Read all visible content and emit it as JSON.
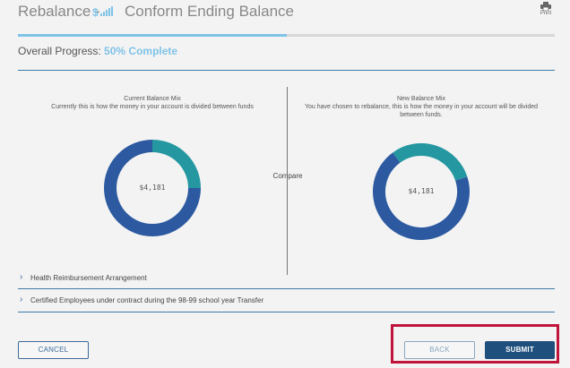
{
  "header": {
    "title": "Rebalance -",
    "subtitle": "Conform Ending Balance",
    "print_label": "Print"
  },
  "progress": {
    "label": "Overall Progress:",
    "percent_text": "50% Complete",
    "value": 0.5
  },
  "current_mix": {
    "heading": "Current Balance Mix",
    "description": "Currently this is how the money in your account is divided between funds",
    "amount": "$4,181"
  },
  "new_mix": {
    "heading": "New Balance Mix",
    "description": "You have chosen to rebalance, this is how the money in your account will be divided between funds.",
    "amount": "$4,181"
  },
  "compare_label": "Compare",
  "accordions": [
    {
      "label": "Health Reimbursement Arrangement"
    },
    {
      "label": "Certified Employees under contract during the 98-99 school year Transfer"
    }
  ],
  "buttons": {
    "cancel": "CANCEL",
    "back": "BACK",
    "submit": "SUBMIT"
  },
  "colors": {
    "primary_fund": "#2c59a0",
    "secondary_fund": "#2597a0",
    "accent": "#7fc3e8",
    "highlight": "#c0143c"
  },
  "chart_data": [
    {
      "type": "pie",
      "title": "Current Balance Mix",
      "values": [
        75,
        25
      ],
      "center_label": "$4,181"
    },
    {
      "type": "pie",
      "title": "New Balance Mix",
      "values": [
        70,
        30
      ],
      "center_label": "$4,181"
    }
  ]
}
